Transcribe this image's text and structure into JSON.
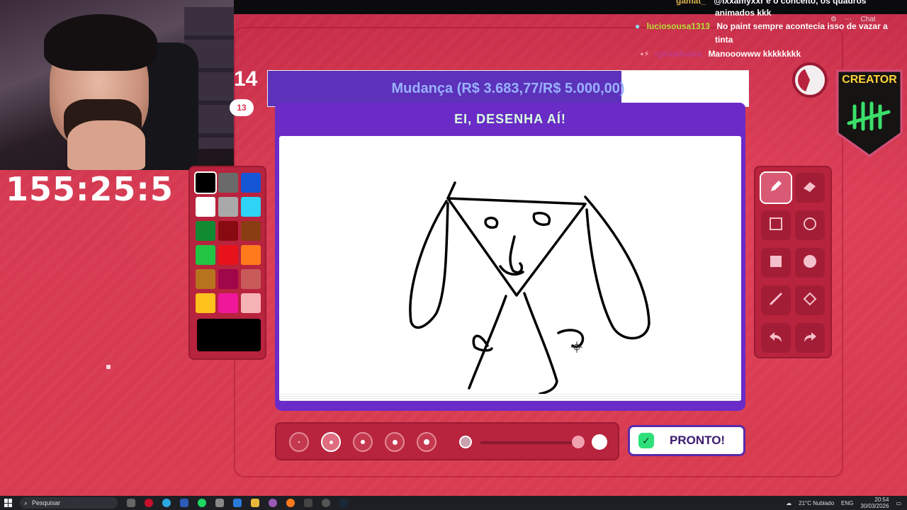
{
  "stream": {
    "timer": "155:25:5",
    "round_number": "14",
    "round_badge": "13"
  },
  "chat": {
    "messages": [
      {
        "user": "gamat_",
        "text": "@ixxamyxxr e o conceito, os quadros"
      },
      {
        "user": "",
        "text": "animados kkk"
      },
      {
        "user": "luciosousa1313",
        "text": "No paint sempre acontecia isso de vazar a"
      },
      {
        "user": "",
        "text": "tinta"
      },
      {
        "user": "rykaailveira",
        "text": "Manooowww kkkkkkkk"
      }
    ],
    "chat_label": "Chat"
  },
  "donation": {
    "text": "Mudança (R$ 3.683,77/R$ 5.000,00)",
    "progress": 0.7367
  },
  "game": {
    "prompt": "EI, DESENHA AÍ!",
    "done_label": "PRONTO!",
    "creator_label": "CREATOR"
  },
  "palette": {
    "colors": [
      "#000000",
      "#6a6a6a",
      "#1456d6",
      "#ffffff",
      "#a9a9a9",
      "#2fd3f5",
      "#118a32",
      "#8a0a12",
      "#8a3d12",
      "#22c444",
      "#e8121a",
      "#ff7a1c",
      "#b7731e",
      "#a0064a",
      "#c95a5a",
      "#ffc21c",
      "#f0189a",
      "#f6b3b6"
    ],
    "selected": "#000000",
    "current_color": "#000000"
  },
  "tools": [
    {
      "name": "pencil-tool",
      "icon": "pencil-icon",
      "active": true
    },
    {
      "name": "eraser-tool",
      "icon": "eraser-icon",
      "active": false
    },
    {
      "name": "rect-outline-tool",
      "icon": "square-outline-icon",
      "active": false
    },
    {
      "name": "circle-outline-tool",
      "icon": "circle-outline-icon",
      "active": false
    },
    {
      "name": "rect-fill-tool",
      "icon": "square-filled-icon",
      "active": false
    },
    {
      "name": "circle-fill-tool",
      "icon": "circle-filled-icon",
      "active": false
    },
    {
      "name": "line-tool",
      "icon": "line-icon",
      "active": false
    },
    {
      "name": "fill-bucket-tool",
      "icon": "bucket-icon",
      "active": false
    },
    {
      "name": "undo-tool",
      "icon": "undo-icon",
      "active": false
    },
    {
      "name": "redo-tool",
      "icon": "redo-icon",
      "active": false
    }
  ],
  "brush_sizes": {
    "count": 5,
    "selected_index": 1
  },
  "taskbar": {
    "search_placeholder": "Pesquisar",
    "weather": "21°C Nublado",
    "lang": "ENG",
    "time": "20:54",
    "date": "30/03/2026"
  },
  "colors": {
    "background": "#d8364f",
    "panel_purple": "#6a2bc6",
    "donation_fill": "#5b32b9",
    "accent_green": "#2ee07a"
  }
}
